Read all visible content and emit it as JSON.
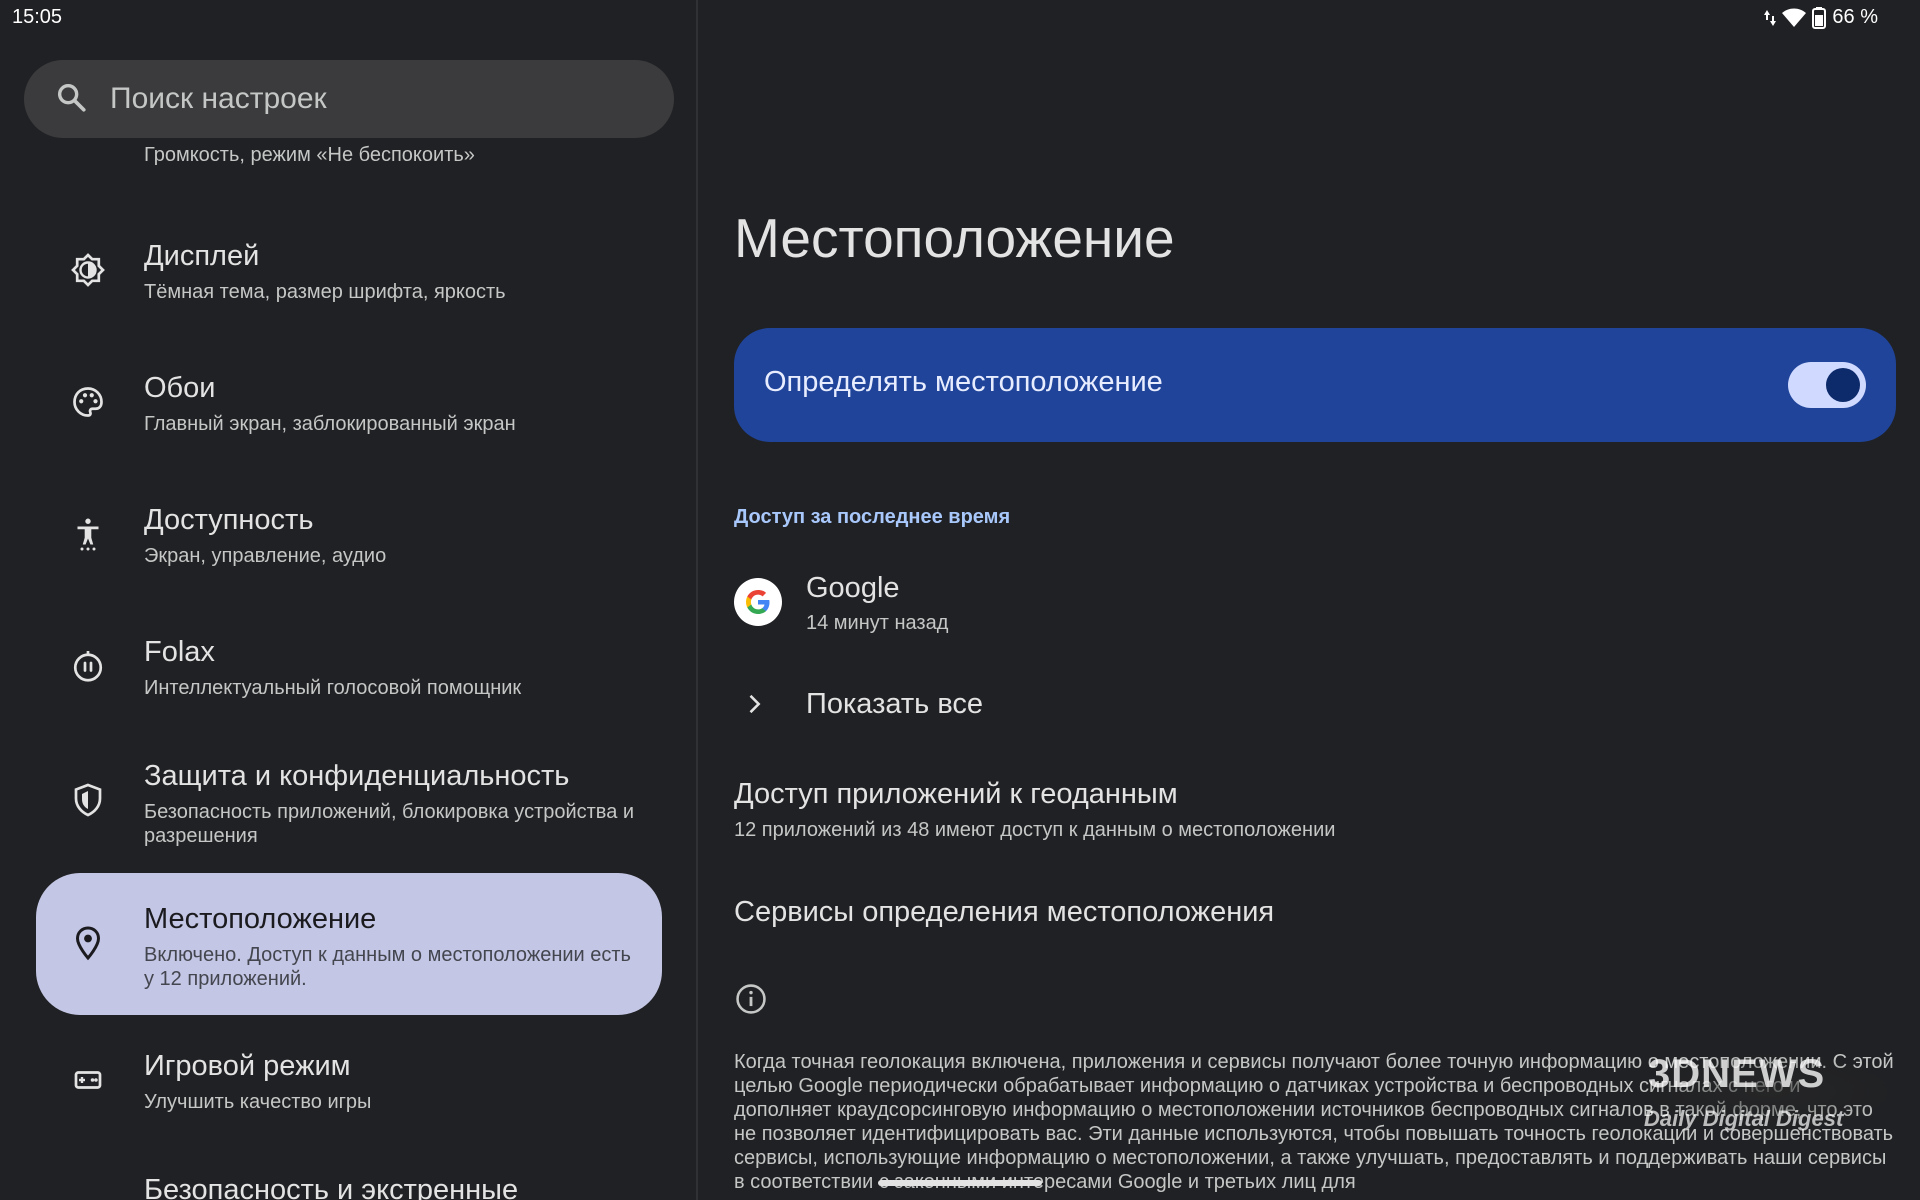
{
  "status_bar": {
    "time": "15:05",
    "battery": "66 %",
    "icons": [
      "data-arrows-icon",
      "wifi-icon",
      "battery-icon"
    ]
  },
  "search": {
    "placeholder": "Поиск настроек"
  },
  "sidebar": {
    "partial_top_text": "Громкость, режим «Не беспокоить»",
    "items": [
      {
        "icon": "brightness-icon",
        "title": "Дисплей",
        "subtitle": "Тёмная тема, размер шрифта, яркость"
      },
      {
        "icon": "palette-icon",
        "title": "Обои",
        "subtitle": "Главный экран, заблокированный экран"
      },
      {
        "icon": "accessibility-icon",
        "title": "Доступность",
        "subtitle": "Экран, управление, аудио"
      },
      {
        "icon": "assistant-icon",
        "title": "Folax",
        "subtitle": "Интеллектуальный голосовой помощник"
      },
      {
        "icon": "shield-icon",
        "title": "Защита и конфиденциальность",
        "subtitle": "Безопасность приложений, блокировка устройства и разрешения"
      },
      {
        "icon": "location-pin-icon",
        "title": "Местоположение",
        "subtitle": "Включено. Доступ к данным о местоположении есть у 12 приложений.",
        "selected": true
      },
      {
        "icon": "gamepad-icon",
        "title": "Игровой режим",
        "subtitle": "Улучшить качество игры"
      },
      {
        "icon": "emergency-icon",
        "title": "Безопасность и экстренные"
      }
    ]
  },
  "main": {
    "title": "Местоположение",
    "toggle": {
      "label": "Определять местоположение",
      "on": true
    },
    "recent_header": "Доступ за последнее время",
    "recent_apps": [
      {
        "name": "Google",
        "time": "14 минут назад"
      }
    ],
    "show_all": "Показать все",
    "app_access": {
      "title": "Доступ приложений к геоданным",
      "subtitle": "12 приложений из 48 имеют доступ к данным о местоположении"
    },
    "services": {
      "title": "Сервисы определения местоположения"
    },
    "footer_text": "Когда точная геолокация включена, приложения и сервисы получают более точную информацию о местоположении. С этой целью Google периодически обрабатывает информацию о датчиках устройства и беспроводных сигналах с него и дополняет краудсорсинговую информацию о местоположении источников беспроводных сигналов в такой форме, что это не позволяет идентифицировать вас. Эти данные используются, чтобы повышать точность геолокации и совершенствовать сервисы, использующие информацию о местоположении, а также улучшать, предоставлять и поддерживать наши сервисы в соответствии с законными интересами Google и третьих лиц для"
  },
  "watermark": {
    "logo": "3DNEWS",
    "tagline": "Daily Digital Digest"
  },
  "colors": {
    "background": "#202124",
    "toggle_card": "#1f4499",
    "selected_item": "#c3c6e4",
    "section_header": "#a8c7fa"
  }
}
